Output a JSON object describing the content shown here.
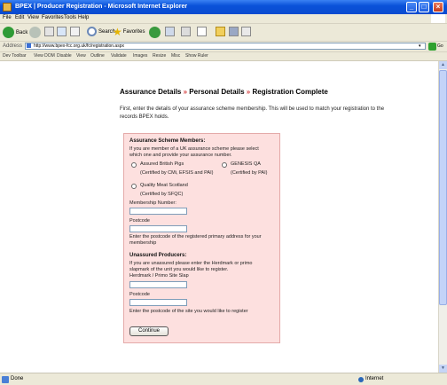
{
  "window": {
    "title": "BPEX | Producer Registration - Microsoft Internet Explorer",
    "controls": {
      "minimize": "_",
      "maximize": "□",
      "close": "×"
    }
  },
  "menubar": [
    "File",
    "Edit",
    "View",
    "Favorites",
    "Tools",
    "Help"
  ],
  "toolbar": {
    "back_label": "Back",
    "search_label": "Search",
    "favorites_label": "Favorites"
  },
  "address": {
    "label": "Address",
    "url": "http://www.bpex-fcc.org.uk/fc/registration.aspx",
    "go_label": "Go"
  },
  "devbar": [
    "Dev Toolbar",
    "View DOM",
    "Disable",
    "View",
    "Outline",
    "Validate",
    "Images",
    "Resize",
    "Misc",
    "Show Ruler"
  ],
  "breadcrumb": {
    "step1": "Assurance Details",
    "step2": "Personal Details",
    "step3": "Registration Complete",
    "separator": "»"
  },
  "intro": {
    "text": "First, enter the details of your assurance scheme membership. This will be used to match your registration to the records BPEX holds."
  },
  "form": {
    "assured_heading": "Assurance Scheme Members:",
    "assured_intro_1": "If you are member of a UK assurance scheme please select",
    "assured_intro_2": "which one and provide your assurance number.",
    "scheme_1": "Assured British Pigs",
    "scheme_1_sub": "(Certified by CMi, EFSIS and PAI)",
    "scheme_2": "GENESIS QA",
    "scheme_2_sub": "(Certified by PAI)",
    "scheme_3": "Quality Meat Scotland",
    "scheme_3_sub": "(Certified by SFQC)",
    "membership_label": "Membership Number:",
    "postcode_label": "Postcode",
    "postcode_help_1": "Enter the postcode of the registered primary address for your",
    "postcode_help_2": "membership",
    "unassured_heading": "Unassured Producers:",
    "unassured_intro_1": "If you are unassured please enter the Herdmark or primo",
    "unassured_intro_2": "slapmark of the unit you would like to register.",
    "herdmark_label": "Herdmark / Primo Site Slap",
    "postcode2_label": "Postcode",
    "postcode2_help": "Enter the postcode of the site you would like to register",
    "continue_label": "Continue"
  },
  "status": {
    "left": "Done",
    "zone": "Internet"
  },
  "colors": {
    "panel_bg": "#fde0df",
    "panel_border": "#e4aaa9",
    "titlebar": "#0a52d9",
    "step_arrow": "#d43b3b"
  }
}
